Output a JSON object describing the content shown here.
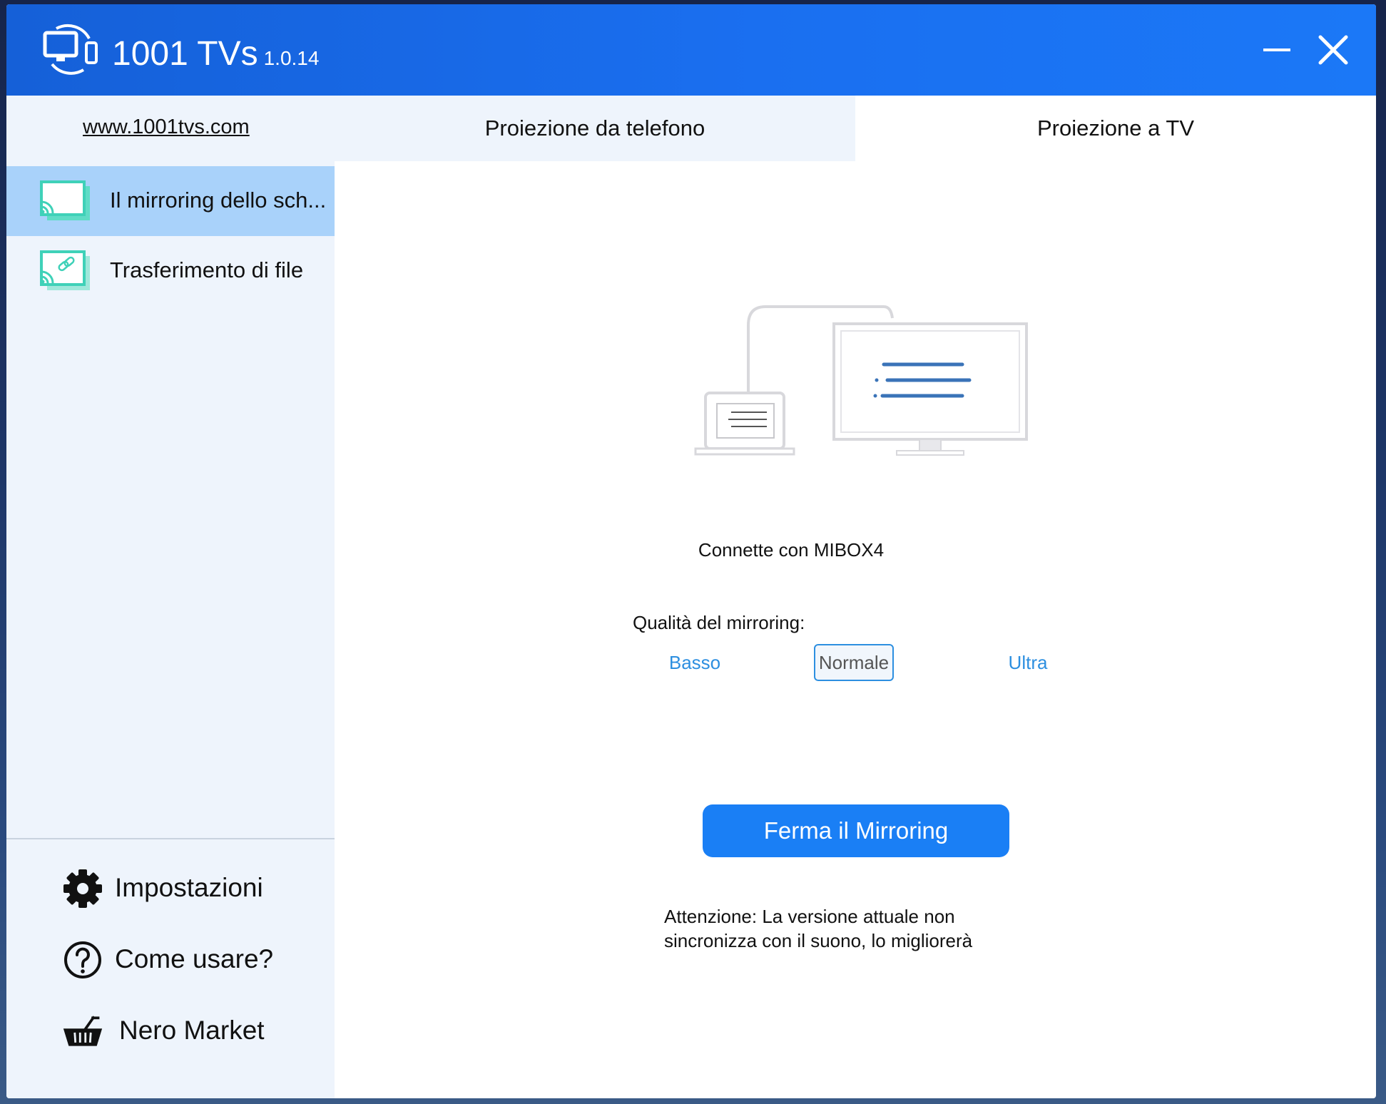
{
  "titlebar": {
    "app_name": "1001 TVs",
    "version": "1.0.14",
    "app_icon": "screen-mirror-logo-icon",
    "minimize_icon": "minimize-icon",
    "close_icon": "close-icon"
  },
  "sidebar": {
    "website": "www.1001tvs.com",
    "items": [
      {
        "label": "Il mirroring dello sch...",
        "icon": "cast-screen-icon",
        "active": true
      },
      {
        "label": "Trasferimento di file",
        "icon": "cast-link-icon",
        "active": false
      }
    ],
    "bottom_items": [
      {
        "label": "Impostazioni",
        "icon": "gear-icon"
      },
      {
        "label": "Come usare?",
        "icon": "help-icon"
      },
      {
        "label": "Nero Market",
        "icon": "basket-icon"
      }
    ]
  },
  "tabs": [
    {
      "label": "Proiezione da telefono",
      "active": false
    },
    {
      "label": "Proiezione a TV",
      "active": true
    }
  ],
  "main": {
    "connected_text": "Connette con MIBOX4",
    "quality_label": "Qualità del mirroring:",
    "quality_options": [
      "Basso",
      "Normale",
      "Ultra"
    ],
    "quality_selected": "Normale",
    "stop_button": "Ferma il Mirroring",
    "note_line1": "Attenzione: La versione attuale non",
    "note_line2": "sincronizza con il suono, lo migliorerà"
  },
  "colors": {
    "titlebar": "#1a6ff0",
    "sidebar_bg": "#eef4fc",
    "active_item": "#a9d2fa",
    "accent_teal": "#3fd1b8",
    "primary_button": "#1a7ff5",
    "link_blue": "#2d8fe0"
  }
}
